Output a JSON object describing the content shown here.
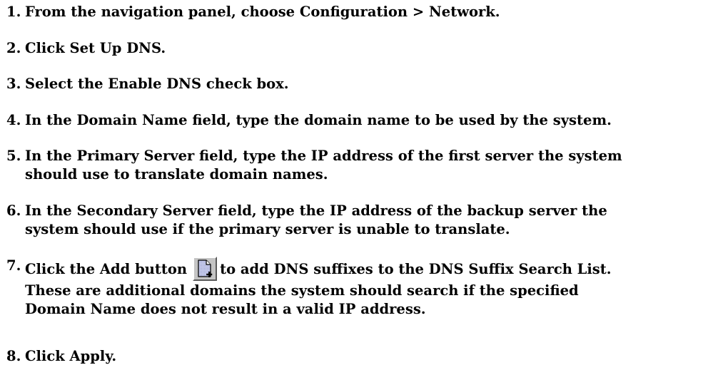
{
  "steps": [
    {
      "number": "1.",
      "lines": [
        "From the navigation panel, choose Configuration > Network."
      ]
    },
    {
      "number": "2.",
      "lines": [
        "Click Set Up DNS."
      ]
    },
    {
      "number": "3.",
      "lines": [
        "Select the Enable DNS check box."
      ]
    },
    {
      "number": "4.",
      "lines": [
        "In the Domain Name field, type the domain name to be used by the system."
      ]
    },
    {
      "number": "5.",
      "lines": [
        "In the Primary Server field, type the IP address of the first server the system",
        "should use to translate domain names."
      ]
    },
    {
      "number": "6.",
      "lines": [
        "In the Secondary Server field, type the IP address of the backup server the",
        "system should use if the primary server is unable to translate."
      ]
    },
    {
      "number": "7.",
      "line1_before_icon": "Click the Add button",
      "line1_after_icon": "to add DNS suffixes to the DNS Suffix Search List.",
      "icon": "add-document-icon",
      "lines": [
        "These are additional domains the system should search if the specified",
        "Domain Name does not result in a valid IP address."
      ]
    },
    {
      "number": "8.",
      "lines": [
        "Click Apply."
      ]
    }
  ]
}
